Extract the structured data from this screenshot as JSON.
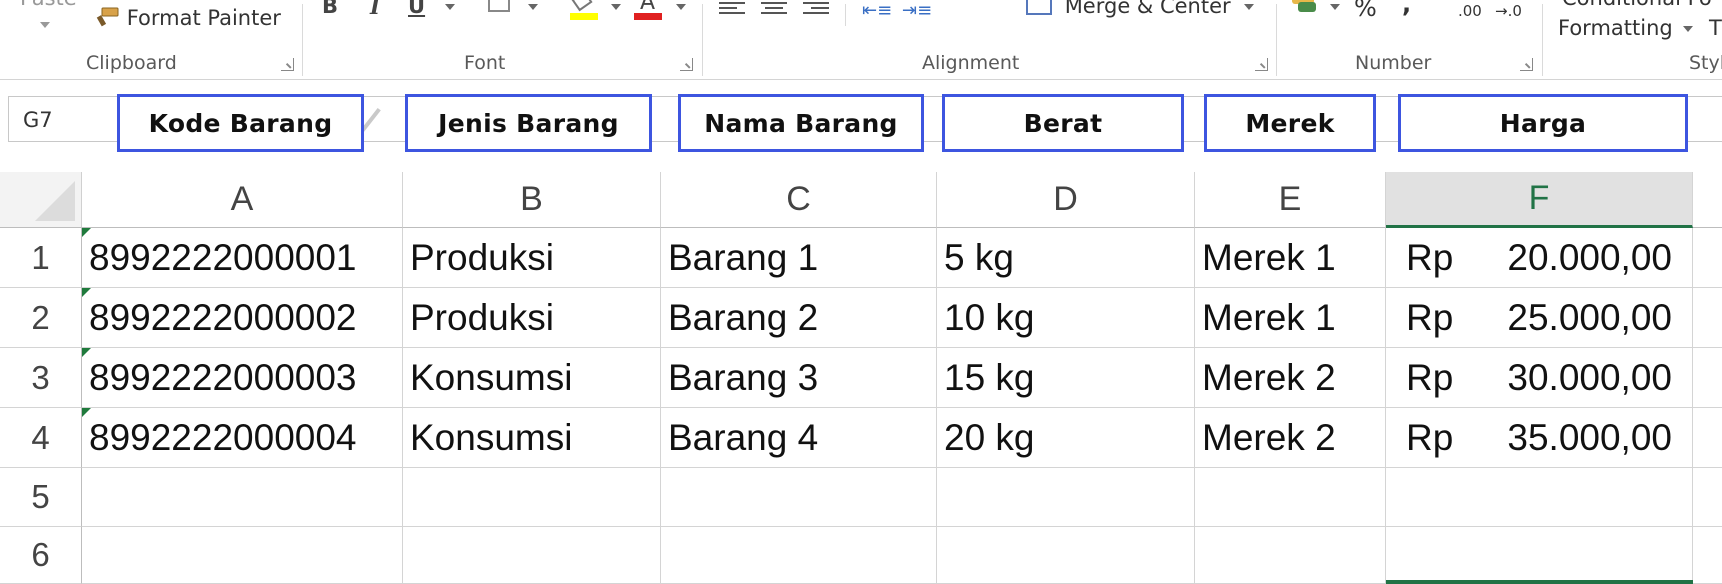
{
  "ribbon": {
    "paste_label": "Paste",
    "format_painter_label": "Format Painter",
    "bold_label": "B",
    "italic_label": "I",
    "underline_label": "U",
    "font_color_glyph": "A",
    "merge_center_label": "Merge & Center",
    "percent_label": "%",
    "comma_label": ",",
    "increase_decimal_label": ".00",
    "decrease_decimal_label": "→.0",
    "conditional_label": "Conditional Fo",
    "formatting_label": "Formatting",
    "table_label": "T",
    "groups": {
      "clipboard": "Clipboard",
      "font": "Font",
      "alignment": "Alignment",
      "number": "Number",
      "styles": "Styl"
    },
    "colors": {
      "highlight": "#ffff00",
      "font_color": "#e02020"
    }
  },
  "formula_bar": {
    "name_box": "G7"
  },
  "annotation_labels": [
    "Kode Barang",
    "Jenis Barang",
    "Nama Barang",
    "Berat",
    "Merek",
    "Harga"
  ],
  "grid": {
    "selected_column": "F",
    "columns": [
      "A",
      "B",
      "C",
      "D",
      "E",
      "F"
    ],
    "row_numbers": [
      "1",
      "2",
      "3",
      "4",
      "5",
      "6"
    ],
    "rows": [
      {
        "code": "8992222000001",
        "type": "Produksi",
        "name": "Barang 1",
        "weight": "5 kg",
        "brand": "Merek 1",
        "currency": "Rp",
        "price": "20.000,00"
      },
      {
        "code": "8992222000002",
        "type": "Produksi",
        "name": "Barang 2",
        "weight": "10 kg",
        "brand": "Merek 1",
        "currency": "Rp",
        "price": "25.000,00"
      },
      {
        "code": "8992222000003",
        "type": "Konsumsi",
        "name": "Barang 3",
        "weight": "15 kg",
        "brand": "Merek 2",
        "currency": "Rp",
        "price": "30.000,00"
      },
      {
        "code": "8992222000004",
        "type": "Konsumsi",
        "name": "Barang 4",
        "weight": "20 kg",
        "brand": "Merek 2",
        "currency": "Rp",
        "price": "35.000,00"
      }
    ],
    "colors": {
      "selection": "#217346",
      "annotation_border": "#3d55e0"
    }
  }
}
